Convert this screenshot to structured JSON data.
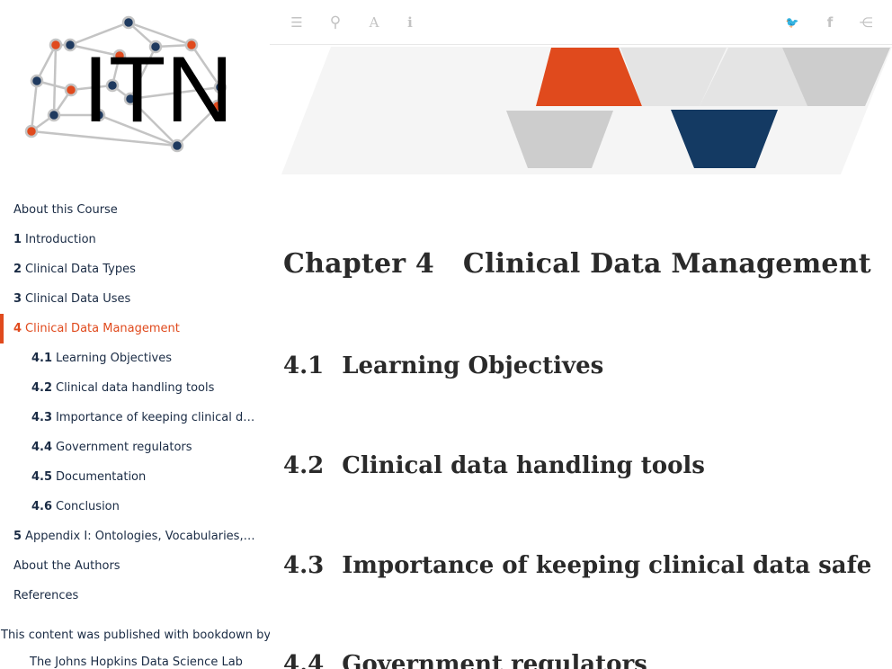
{
  "logo": {
    "text": "ITN"
  },
  "toolbar": {
    "toc_icon": "☰",
    "search_icon": "⚲",
    "font_icon": "A",
    "info_icon": "i",
    "twitter_icon": "🐦",
    "facebook_icon": "f",
    "share_icon": "⋲"
  },
  "sidebar": {
    "items": [
      {
        "num": "",
        "label": "About this Course"
      },
      {
        "num": "1",
        "label": "Introduction"
      },
      {
        "num": "2",
        "label": "Clinical Data Types"
      },
      {
        "num": "3",
        "label": "Clinical Data Uses"
      },
      {
        "num": "4",
        "label": "Clinical Data Management"
      },
      {
        "num": "4.1",
        "label": "Learning Objectives"
      },
      {
        "num": "4.2",
        "label": "Clinical data handling tools"
      },
      {
        "num": "4.3",
        "label": "Importance of keeping clinical data safe"
      },
      {
        "num": "4.4",
        "label": "Government regulators"
      },
      {
        "num": "4.5",
        "label": "Documentation"
      },
      {
        "num": "4.6",
        "label": "Conclusion"
      },
      {
        "num": "5",
        "label": "Appendix I: Ontologies, Vocabularies, Terminologies"
      },
      {
        "num": "",
        "label": "About the Authors"
      },
      {
        "num": "",
        "label": "References"
      }
    ],
    "published": "This content was published with bookdown by:",
    "publisher": "The Johns Hopkins Data Science Lab"
  },
  "main": {
    "chapter_title": "Chapter 4   Clinical Data Management",
    "sections": [
      {
        "num": "4.1",
        "title": "Learning Objectives"
      },
      {
        "num": "4.2",
        "title": "Clinical data handling tools"
      },
      {
        "num": "4.3",
        "title": "Importance of keeping clinical data safe"
      },
      {
        "num": "4.4",
        "title": "Government regulators"
      }
    ]
  },
  "colors": {
    "accent": "#e04a1d",
    "navy": "#1a2b44",
    "banner_navy": "#143a63",
    "banner_gray": "#c8c8c8"
  }
}
